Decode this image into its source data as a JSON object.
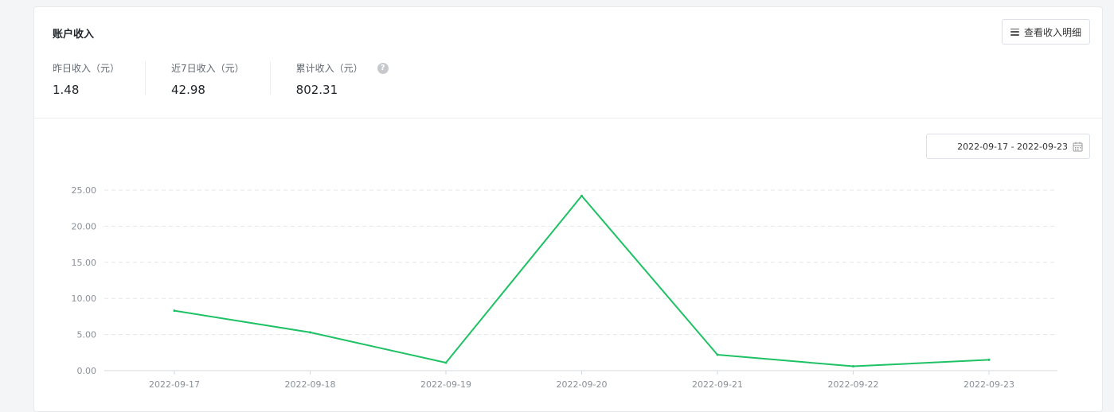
{
  "card": {
    "title": "账户收入",
    "detail_button_label": "查看收入明细"
  },
  "stats": [
    {
      "label": "昨日收入（元）",
      "value": "1.48"
    },
    {
      "label": "近7日收入（元）",
      "value": "42.98"
    },
    {
      "label": "累计收入（元）",
      "value": "802.31",
      "help": "?"
    }
  ],
  "date_range": {
    "value": "2022-09-17 - 2022-09-23"
  },
  "colors": {
    "line": "#1ec164",
    "grid": "#e4e6ea"
  },
  "chart_data": {
    "type": "line",
    "categories": [
      "2022-09-17",
      "2022-09-18",
      "2022-09-19",
      "2022-09-20",
      "2022-09-21",
      "2022-09-22",
      "2022-09-23"
    ],
    "series": [
      {
        "values": [
          8.3,
          5.3,
          1.1,
          24.2,
          2.2,
          0.6,
          1.5
        ]
      }
    ],
    "yticks": [
      "0.00",
      "5.00",
      "10.00",
      "15.00",
      "20.00",
      "25.00"
    ],
    "ylim": [
      0,
      25
    ],
    "grid": true
  }
}
